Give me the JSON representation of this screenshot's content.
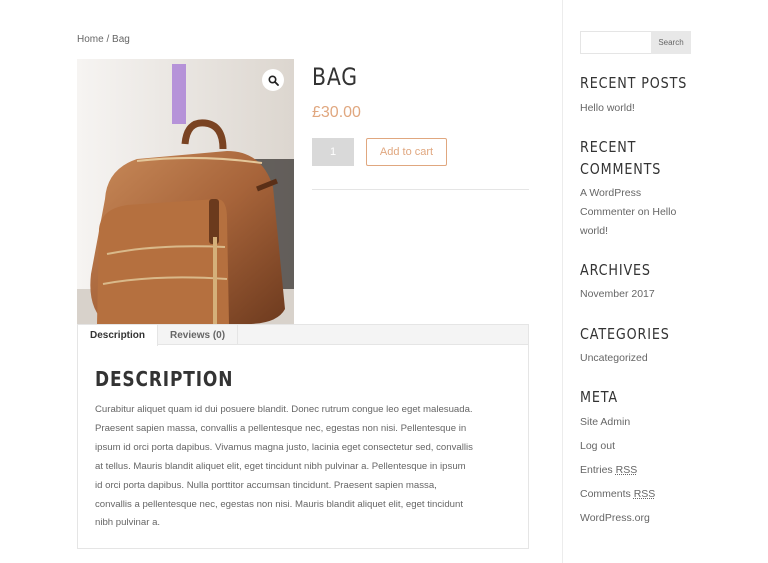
{
  "breadcrumb": {
    "home": "Home",
    "separator": " / ",
    "current": "Bag"
  },
  "product": {
    "title": "BAG",
    "price": "£30.00",
    "quantity": "1",
    "add_to_cart_label": "Add to cart",
    "image_alt": "bag"
  },
  "tabs": [
    {
      "label": "Description"
    },
    {
      "label": "Reviews (0)"
    }
  ],
  "description": {
    "heading": "DESCRIPTION",
    "body_lines": [
      "Curabitur aliquet quam id dui posuere blandit. Donec rutrum congue leo eget malesuada.",
      "Praesent sapien massa, convallis a pellentesque nec, egestas non nisi. Pellentesque in",
      "ipsum id orci porta dapibus. Vivamus magna justo, lacinia eget consectetur sed, convallis",
      "at tellus. Mauris blandit aliquet elit, eget tincidunt nibh pulvinar a. Pellentesque in ipsum",
      "id orci porta dapibus. Nulla porttitor accumsan tincidunt. Praesent sapien massa,",
      "convallis a pellentesque nec, egestas non nisi. Mauris blandit aliquet elit, eget tincidunt",
      "nibh pulvinar a."
    ]
  },
  "sidebar": {
    "search": {
      "placeholder": "",
      "button_label": "Search"
    },
    "recent_posts": {
      "title": "RECENT POSTS",
      "items": [
        "Hello world!"
      ]
    },
    "recent_comments": {
      "title_line1": "RECENT",
      "title_line2": "COMMENTS",
      "lines": [
        "A WordPress",
        "Commenter on Hello",
        "world!"
      ]
    },
    "archives": {
      "title": "ARCHIVES",
      "items": [
        "November 2017"
      ]
    },
    "categories": {
      "title": "CATEGORIES",
      "items": [
        "Uncategorized"
      ]
    },
    "meta": {
      "title": "META",
      "site_admin": "Site Admin",
      "log_out": "Log out",
      "entries_prefix": "Entries ",
      "comments_prefix": "Comments ",
      "rss": "RSS",
      "wordpress_org": "WordPress.org"
    }
  },
  "colors": {
    "accent": "#e0a77f",
    "text": "#666666",
    "heading": "#333333"
  },
  "icons": {
    "zoom": "magnifier-icon"
  }
}
